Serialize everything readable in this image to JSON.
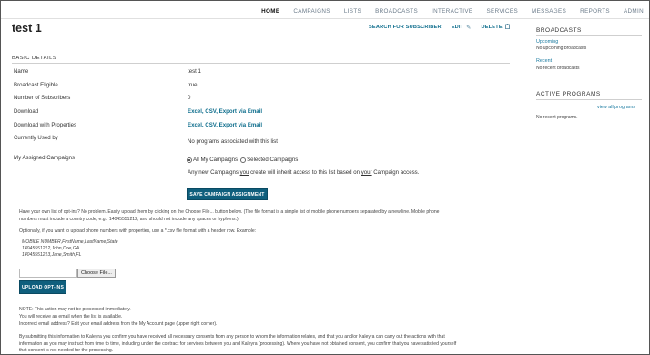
{
  "nav": {
    "items": [
      {
        "label": "HOME",
        "active": true
      },
      {
        "label": "CAMPAIGNS",
        "active": false
      },
      {
        "label": "LISTS",
        "active": false
      },
      {
        "label": "BROADCASTS",
        "active": false
      },
      {
        "label": "INTERACTIVE",
        "active": false
      },
      {
        "label": "SERVICES",
        "active": false
      },
      {
        "label": "MESSAGES",
        "active": false
      },
      {
        "label": "REPORTS",
        "active": false
      },
      {
        "label": "ADMIN",
        "active": false
      }
    ]
  },
  "page": {
    "title": "test 1"
  },
  "actions": {
    "search_label": "SEARCH FOR SUBSCRIBER",
    "edit_label": "EDIT",
    "delete_label": "DELETE"
  },
  "basic": {
    "heading": "BASIC DETAILS",
    "name_label": "Name",
    "name_value": "test 1",
    "broadcast_label": "Broadcast Eligible",
    "broadcast_value": "true",
    "subscribers_label": "Number of Subscribers",
    "subscribers_value": "0",
    "download_label": "Download",
    "download_links": "Excel, CSV, Export via Email",
    "download_props_label": "Download with Properties",
    "download_props_links": "Excel, CSV, Export via Email",
    "used_by_label": "Currently Used by",
    "used_by_value": "No programs associated with this list",
    "assigned_label": "My Assigned Campaigns",
    "radio_all": "All My Campaigns",
    "radio_selected": "Selected Campaigns",
    "access_text_1": "Any new Campaigns ",
    "access_text_you": "you",
    "access_text_2": " create will inherit access to this list based on ",
    "access_text_your": "your",
    "access_text_3": " Campaign access.",
    "save_button": "SAVE CAMPAIGN ASSIGNMENT"
  },
  "optins": {
    "intro_1": "Have your own list of opt-ins? No problem. Easily upload them by clicking on the Choose File... button below. (The file format is a simple list of mobile phone numbers separated by a new line. Mobile phone",
    "intro_2": "numbers must include a country code, e.g., 14045551212, and should not include any spaces or hyphens.)",
    "optional": "Optionally, if you want to upload phone numbers with properties, use a *.csv file format with a header row. Example:",
    "example_1": "MOBILE NUMBER,FirstName,LastName,State",
    "example_2": "14045551212,John,Doe,GA",
    "example_3": "14045551213,Jane,Smith,FL",
    "choose_file": "Choose File...",
    "upload_button": "UPLOAD OPT-INS",
    "note_1": "NOTE: This action may not be processed immediately.",
    "note_2": "You will receive an email when the list is available.",
    "note_3": "Incorrect email address? Edit your email address from the My Account page (upper right corner).",
    "consent_1": "By submitting this information to Kaleyra you confirm you have received all necessary consents from any person to whom the information relates, and that you and/or Kaleyra can carry out the actions with that",
    "consent_2": "information as you may instruct from time to time, including under the contract for services between you and Kaleyra (processing). Where you have not obtained consent, you confirm that you have satisfied yourself",
    "consent_3": "that consent is not needed for the processing."
  },
  "sidebar": {
    "broadcasts_heading": "BROADCASTS",
    "upcoming_label": "Upcoming",
    "upcoming_empty": "No upcoming broadcasts",
    "recent_label": "Recent",
    "recent_empty": "No recent broadcasts",
    "programs_heading": "ACTIVE PROGRAMS",
    "view_all": "view all programs",
    "programs_empty": "No recent programs."
  },
  "colors": {
    "accent": "#0f5f7d",
    "link": "#0d6d8c"
  }
}
